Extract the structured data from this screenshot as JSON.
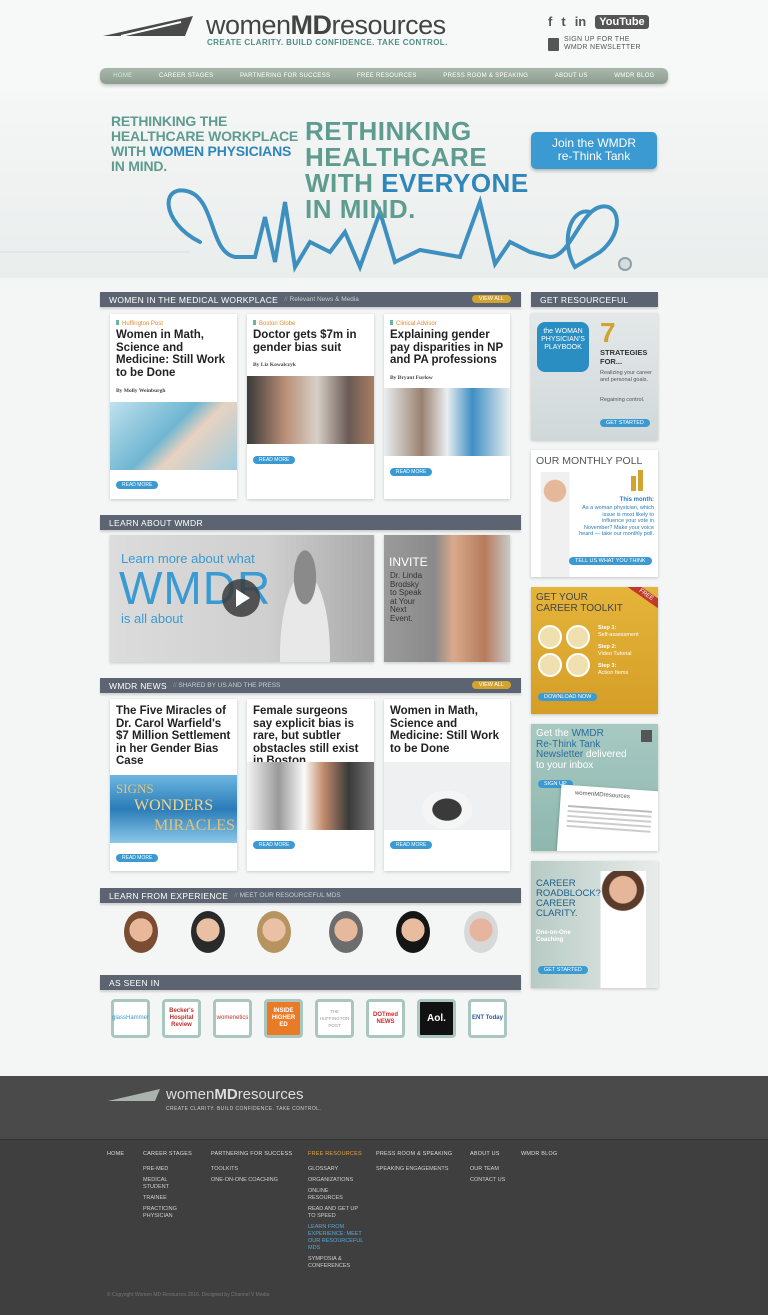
{
  "header": {
    "logo_pre": "women",
    "logo_md": "MD",
    "logo_post": "resources",
    "tagline": "CREATE CLARITY. BUILD CONFIDENCE. TAKE CONTROL.",
    "social": {
      "facebook": "f",
      "twitter": "t",
      "linkedin": "in",
      "youtube": "YouTube"
    },
    "newsletter_line1": "SIGN UP FOR THE",
    "newsletter_line2": "WMDR NEWSLETTER"
  },
  "nav": [
    "HOME",
    "CAREER STAGES",
    "PARTNERING FOR SUCCESS",
    "FREE RESOURCES",
    "PRESS ROOM & SPEAKING",
    "ABOUT US",
    "WMDR BLOG"
  ],
  "hero": {
    "left_l1": "RETHINKING THE",
    "left_l2": "HEALTHCARE WORKPLACE",
    "left_l3a": "WITH ",
    "left_l3b": "WOMEN PHYSICIANS",
    "left_l4": "IN MIND.",
    "main_l1": "RETHINKING",
    "main_l2": "HEALTHCARE",
    "main_l3a": "WITH ",
    "main_l3b": "EVERYONE",
    "main_l4": "IN MIND.",
    "button_l1": "Join the WMDR",
    "button_l2": "re-Think Tank"
  },
  "workplace": {
    "title": "WOMEN IN THE MEDICAL WORKPLACE",
    "subtitle": "Relevant News & Media",
    "view_all": "VIEW ALL",
    "cards": [
      {
        "source": "Huffington Post",
        "headline": "Women in Math, Science and Medicine: Still Work to be Done",
        "byline": "By Molly Weinburgh",
        "cta": "READ MORE"
      },
      {
        "source": "Boston Globe",
        "headline": "Doctor gets $7m in gender bias suit",
        "byline": "By Liz Kowalczyk",
        "cta": "READ MORE"
      },
      {
        "source": "Clinical Advisor",
        "headline": "Explaining gender pay disparities in NP and PA professions",
        "byline": "By Bryant Furlow",
        "cta": "READ MORE"
      }
    ]
  },
  "learn": {
    "title": "LEARN ABOUT WMDR",
    "video_l1": "Learn more about what",
    "video_l2": "WMDR",
    "video_l3": "is all about",
    "invite_title": "INVITE",
    "invite_l1": "Dr. Linda",
    "invite_l2": "Brodsky",
    "invite_l3": "to Speak",
    "invite_l4": "at Your",
    "invite_l5": "Next",
    "invite_l6": "Event."
  },
  "news": {
    "title": "WMDR NEWS",
    "subtitle": "SHARED BY US AND THE PRESS",
    "view_all": "VIEW ALL",
    "cards": [
      {
        "headline": "The Five Miracles of Dr. Carol Warfield's $7 Million Settlement in her Gender Bias Case",
        "cta": "READ MORE",
        "img_text_1": "SIGNS",
        "img_text_2": "WONDERS",
        "img_text_3": "MIRACLES"
      },
      {
        "headline": "Female surgeons say explicit bias is rare, but subtler obstacles still exist in Boston",
        "cta": "READ MORE"
      },
      {
        "headline": "Women in Math, Science and Medicine: Still Work to be Done",
        "cta": "READ MORE"
      }
    ]
  },
  "experience": {
    "title": "LEARN FROM EXPERIENCE",
    "subtitle": "MEET OUR RESOURCEFUL MDS"
  },
  "seen": {
    "title": "AS SEEN IN",
    "logos": [
      "glassHammer",
      "Becker's Hospital Review",
      "womenetics",
      "INSIDE HIGHER ED",
      "THE HUFFINGTON POST",
      "DOTmed NEWS",
      "Aol.",
      "ENT Today"
    ]
  },
  "sidebar": {
    "title": "GET RESOURCEFUL",
    "playbook": {
      "book_l1": "the WOMAN",
      "book_l2": "PHYSICIAN'S",
      "book_l3": "PLAYBOOK",
      "num": "7",
      "heading_l1": "STRATEGIES",
      "heading_l2": "FOR...",
      "text1": "Realizing your career and personal goals.",
      "text2": "Regaining control.",
      "cta": "GET STARTED"
    },
    "poll": {
      "title": "OUR MONTHLY POLL",
      "label": "This month:",
      "text": "As a woman physician, which issue is most likely to influence your vote in November? Make your voice heard — take our monthly poll.",
      "cta": "TELL US WHAT YOU THINK"
    },
    "toolkit": {
      "title_l1": "GET YOUR",
      "title_l2": "CAREER TOOLKIT",
      "ribbon": "FREE",
      "step1": "Step 1:",
      "step1b": "Self-assessment",
      "step2": "Step 2:",
      "step2b": "Video Tutorial",
      "step3": "Step 3:",
      "step3b": "Action Items",
      "cta": "DOWNLOAD NOW"
    },
    "newsletter": {
      "l1a": "Get the ",
      "l1b": "WMDR",
      "l2": "Re-Think Tank",
      "l3a": "Newsletter ",
      "l3b": "delivered",
      "l4": "to your inbox",
      "cta": "SIGN UP",
      "mini_logo": "womenMDresources"
    },
    "coaching": {
      "l1": "CAREER",
      "l2": "ROADBLOCK?",
      "l3": "CAREER",
      "l4": "CLARITY.",
      "sub_l1": "One-on-One",
      "sub_l2": "Coaching",
      "cta": "GET STARTED"
    }
  },
  "footer": {
    "logo_pre": "women",
    "logo_md": "MD",
    "logo_post": "resources",
    "tagline": "CREATE CLARITY. BUILD CONFIDENCE. TAKE CONTROL.",
    "cols": [
      {
        "head": "HOME",
        "items": []
      },
      {
        "head": "CAREER STAGES",
        "items": [
          "PRE-MED",
          "MEDICAL STUDENT",
          "TRAINEE",
          "PRACTICING PHYSICIAN"
        ]
      },
      {
        "head": "PARTNERING FOR SUCCESS",
        "items": [
          "TOOLKITS",
          "ONE-ON-ONE COACHING"
        ]
      },
      {
        "head": "FREE RESOURCES",
        "items": [
          "GLOSSARY",
          "ORGANIZATIONS",
          "ONLINE RESOURCES",
          "READ AND GET UP TO SPEED",
          "LEARN FROM EXPERIENCE: MEET OUR RESOURCEFUL MDS",
          "SYMPOSIA & CONFERENCES"
        ]
      },
      {
        "head": "PRESS ROOM & SPEAKING",
        "items": [
          "SPEAKING ENGAGEMENTS"
        ]
      },
      {
        "head": "ABOUT US",
        "items": [
          "OUR TEAM",
          "CONTACT US"
        ]
      },
      {
        "head": "WMDR BLOG",
        "items": []
      }
    ],
    "copyright": "© Copyright Women MD Resources 2016. Designed by Channel V Media"
  },
  "colors": {
    "accent_blue": "#3a9ad1",
    "teal": "#5f9c90",
    "bar_gray": "#5b6470",
    "gold": "#d1a431",
    "footer_bg": "#3f3f40"
  }
}
